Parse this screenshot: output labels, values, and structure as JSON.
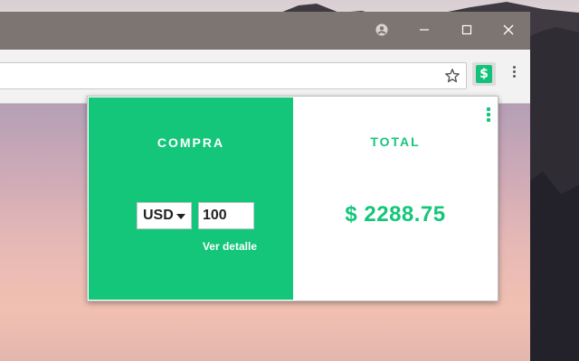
{
  "browser": {
    "window_controls": {
      "profile_icon": "account-circle-icon",
      "minimize_icon": "minimize-icon",
      "maximize_icon": "maximize-icon",
      "close_icon": "close-icon"
    },
    "toolbar": {
      "bookmark_icon": "star-icon",
      "extension_icon": "dollar-icon",
      "extension_symbol": "$",
      "menu_icon": "kebab-menu-icon"
    }
  },
  "popup": {
    "left": {
      "title": "COMPRA",
      "currency": "USD",
      "amount": "100",
      "detail_link": "Ver detalle"
    },
    "right": {
      "title": "TOTAL",
      "total": "$ 2288.75"
    },
    "menu_icon": "kebab-menu-icon"
  },
  "colors": {
    "accent": "#14c679",
    "titlebar": "#7d7572",
    "toolbar": "#f2f2f2"
  }
}
